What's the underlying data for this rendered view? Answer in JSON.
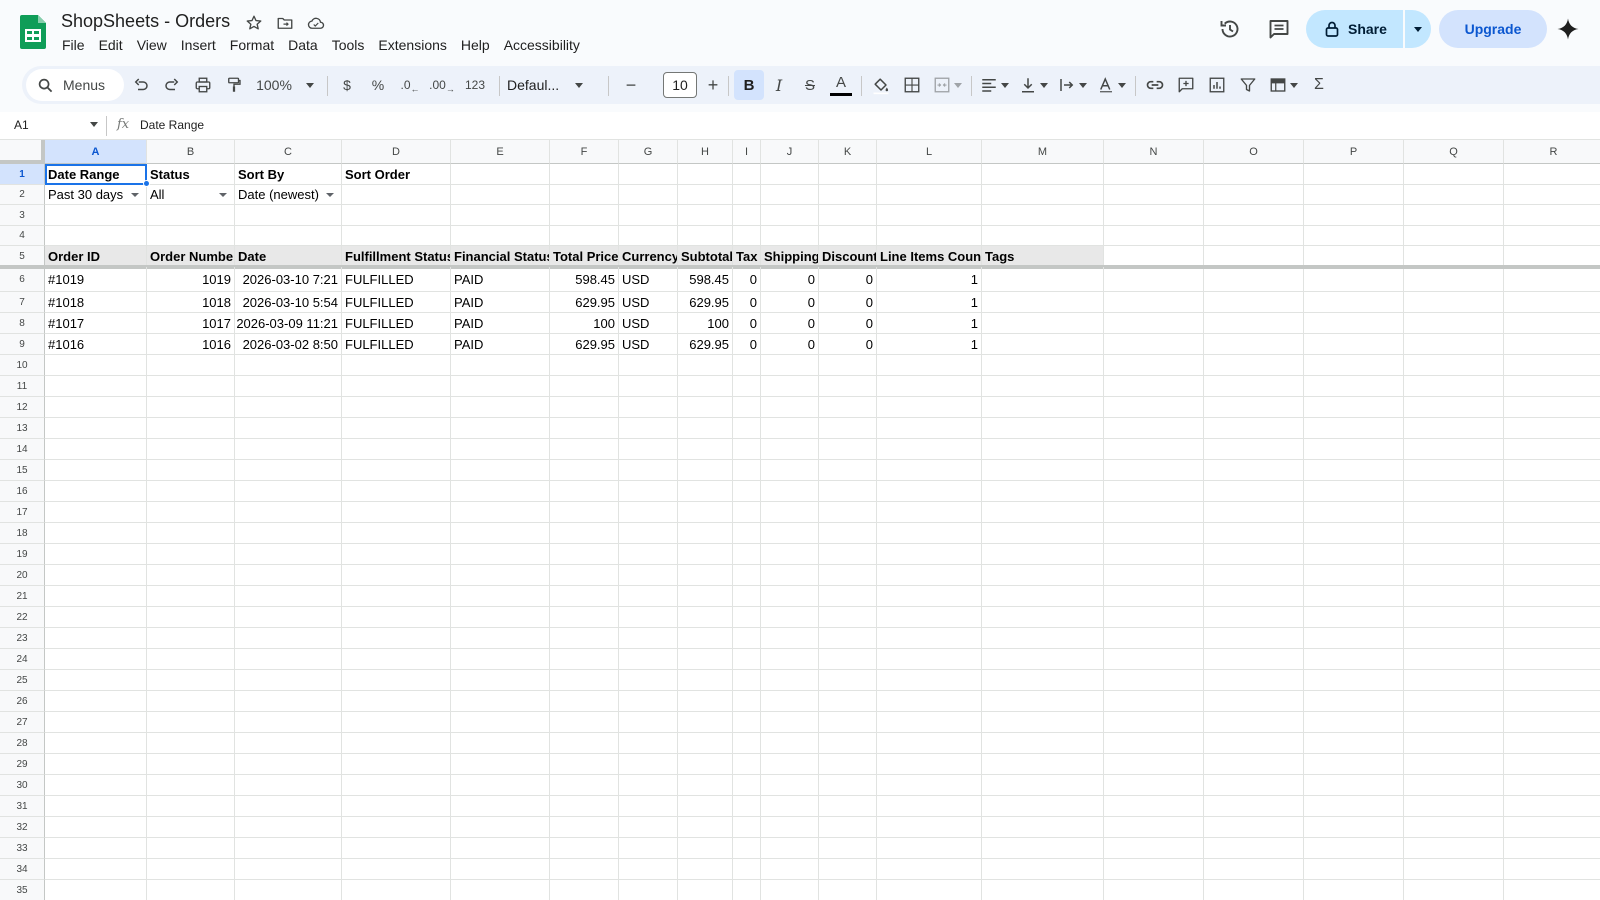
{
  "app": {
    "title": "ShopSheets - Orders",
    "menu": [
      "File",
      "Edit",
      "View",
      "Insert",
      "Format",
      "Data",
      "Tools",
      "Extensions",
      "Help",
      "Accessibility"
    ]
  },
  "header": {
    "share_label": "Share",
    "upgrade_label": "Upgrade"
  },
  "toolbar": {
    "menus_label": "Menus",
    "zoom": "100%",
    "currency": "$",
    "percent": "%",
    "decrease_decimal": ".0",
    "increase_decimal": ".00",
    "number_format": "123",
    "font": "Defaul...",
    "font_size": "10",
    "bold": "B",
    "italic": "I",
    "strikethrough": "S",
    "text_color": "A",
    "minus": "−",
    "plus": "+",
    "sum": "Σ"
  },
  "formula_bar": {
    "name_box": "A1",
    "fx": "fx",
    "content": "Date Range"
  },
  "colors": {
    "accent": "#1a73e8",
    "share_bg": "#c2e7ff",
    "upgrade_bg": "#d3e3fd",
    "header_row_bg": "#e8e8e8"
  },
  "sheet": {
    "columns": [
      "A",
      "B",
      "C",
      "D",
      "E",
      "F",
      "G",
      "H",
      "I",
      "J",
      "K",
      "L",
      "M",
      "N",
      "O",
      "P",
      "Q",
      "R"
    ],
    "selected_cell": "A1",
    "row_count": 35,
    "filters": {
      "labels": [
        "Date Range",
        "Status",
        "Sort By",
        "Sort Order"
      ],
      "values": [
        "Past 30 days",
        "All",
        "Date (newest)",
        ""
      ]
    },
    "table_headers": [
      "Order ID",
      "Order Numbe",
      "Date",
      "Fulfillment Status",
      "Financial Status",
      "Total Price",
      "Currency",
      "Subtotal",
      "Tax",
      "Shipping",
      "Discount",
      "Line Items Count",
      "Tags"
    ],
    "rows": [
      [
        "#1019",
        "1019",
        "2026-03-10 7:21",
        "FULFILLED",
        "PAID",
        "598.45",
        "USD",
        "598.45",
        "0",
        "0",
        "0",
        "1",
        ""
      ],
      [
        "#1018",
        "1018",
        "2026-03-10 5:54",
        "FULFILLED",
        "PAID",
        "629.95",
        "USD",
        "629.95",
        "0",
        "0",
        "0",
        "1",
        ""
      ],
      [
        "#1017",
        "1017",
        "2026-03-09 11:21",
        "FULFILLED",
        "PAID",
        "100",
        "USD",
        "100",
        "0",
        "0",
        "0",
        "1",
        ""
      ],
      [
        "#1016",
        "1016",
        "2026-03-02 8:50",
        "FULFILLED",
        "PAID",
        "629.95",
        "USD",
        "629.95",
        "0",
        "0",
        "0",
        "1",
        ""
      ]
    ]
  }
}
